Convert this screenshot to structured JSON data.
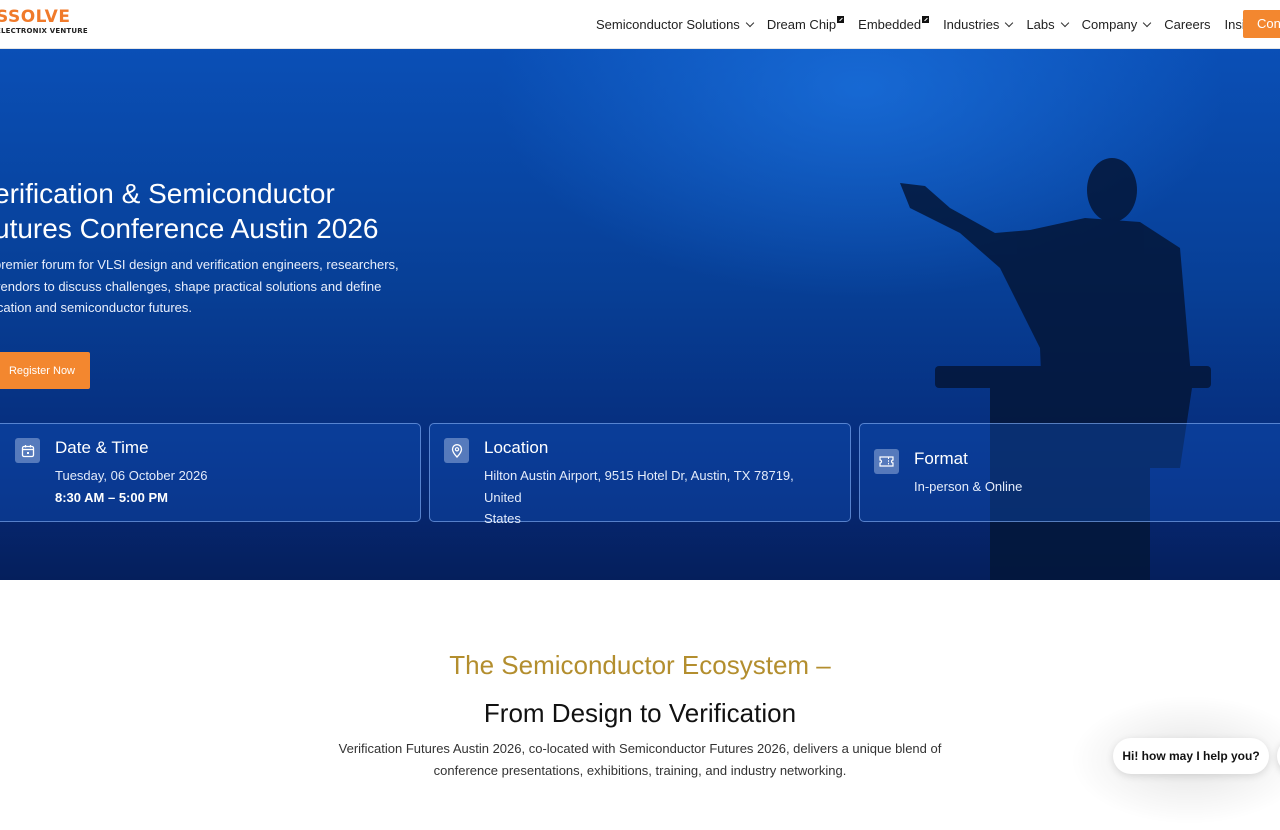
{
  "nav": {
    "logo_main": "SSOLVE",
    "logo_sub": "ELECTRONIX VENTURE",
    "items": [
      {
        "label": "Semiconductor Solutions"
      },
      {
        "label": "Dream Chip"
      },
      {
        "label": "Embedded"
      },
      {
        "label": "Industries"
      },
      {
        "label": "Labs"
      },
      {
        "label": "Company"
      },
      {
        "label": "Careers"
      },
      {
        "label": "Insight"
      }
    ],
    "cta_label": "Con"
  },
  "hero": {
    "title_line1": "erification & Semiconductor",
    "title_line2": "utures Conference Austin 2026",
    "desc_line1": "premier forum for VLSI design and verification engineers, researchers,",
    "desc_line2": "vendors to discuss challenges, shape practical solutions and define",
    "desc_line3": "ication and semiconductor futures.",
    "register_label": "Register Now"
  },
  "cards": {
    "date": {
      "title": "Date & Time",
      "line1": "Tuesday, 06 October 2026",
      "line2": "8:30 AM – 5:00 PM"
    },
    "location": {
      "title": "Location",
      "line1": "Hilton Austin Airport, 9515 Hotel Dr, Austin, TX 78719, United",
      "line2": "States"
    },
    "format": {
      "title": "Format",
      "line1": "In-person & Online"
    }
  },
  "section": {
    "title1": "The Semiconductor Ecosystem –",
    "title2": "From Design to Verification",
    "desc_line1": "Verification Futures Austin 2026, co-located with Semiconductor Futures 2026, delivers a unique blend of",
    "desc_line2": "conference presentations, exhibitions, training, and industry networking."
  },
  "chat": {
    "bubble": "Hi! how may I help you?"
  },
  "colors": {
    "accent": "#f3872f",
    "brand": "#f07a2a",
    "gold": "#b38e2e",
    "hero_blue": "#073f96"
  }
}
